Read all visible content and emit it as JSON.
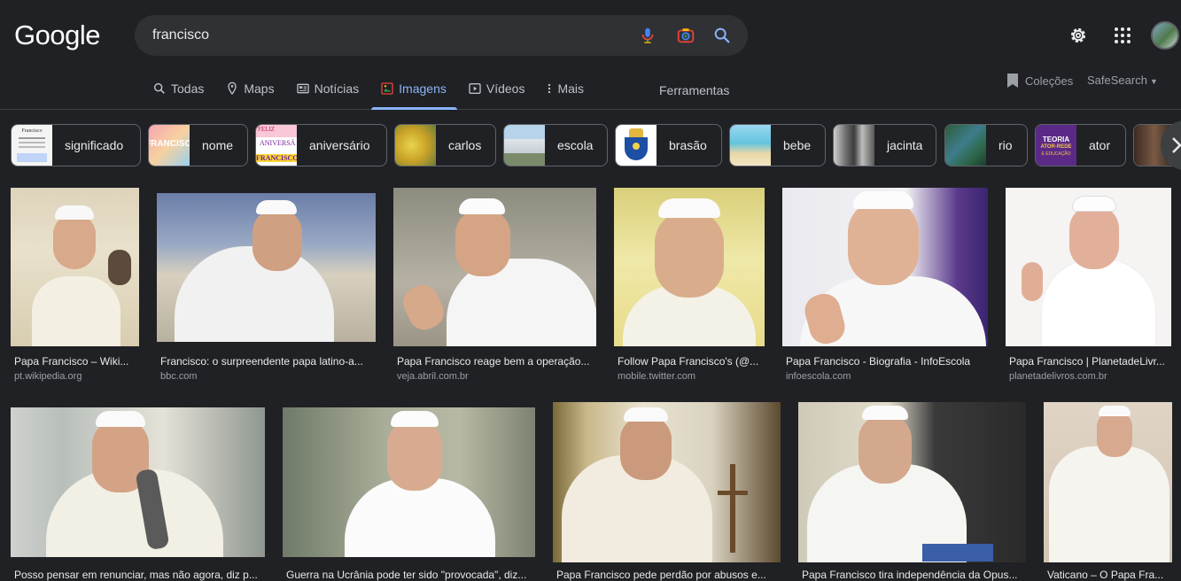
{
  "logo": "Google",
  "search": {
    "value": "francisco"
  },
  "tabs": [
    {
      "label": "Todas",
      "icon": "search-icon"
    },
    {
      "label": "Maps",
      "icon": "map-pin-icon"
    },
    {
      "label": "Notícias",
      "icon": "news-icon"
    },
    {
      "label": "Imagens",
      "icon": "image-icon",
      "active": true
    },
    {
      "label": "Vídeos",
      "icon": "play-icon"
    },
    {
      "label": "Mais",
      "icon": "more-vert-icon"
    }
  ],
  "tools_label": "Ferramentas",
  "collections_label": "Coleções",
  "safesearch_label": "SafeSearch",
  "chips": [
    {
      "label": "significado"
    },
    {
      "label": "nome"
    },
    {
      "label": "aniversário"
    },
    {
      "label": "carlos"
    },
    {
      "label": "escola"
    },
    {
      "label": "brasão"
    },
    {
      "label": "bebe"
    },
    {
      "label": "jacinta"
    },
    {
      "label": "rio"
    },
    {
      "label": "ator"
    }
  ],
  "chip_thumb_text": {
    "significado": "Francisco",
    "nome": "FRANCISCO",
    "aniversario_top": "FELIZ",
    "aniversario_mid": "ANIVERSÁ",
    "aniversario_bottom": "FRANCISCO",
    "ator_top": "TEORIA",
    "ator_mid": "ATOR-REDE",
    "ator_bottom": "E EDUCAÇÃO"
  },
  "results_row1": [
    {
      "title": "Papa Francisco – Wiki...",
      "source": "pt.wikipedia.org"
    },
    {
      "title": "Francisco: o surpreendente papa latino-a...",
      "source": "bbc.com"
    },
    {
      "title": "Papa Francisco reage bem a operação...",
      "source": "veja.abril.com.br"
    },
    {
      "title": "Follow Papa Francisco's (@...",
      "source": "mobile.twitter.com"
    },
    {
      "title": "Papa Francisco - Biografia - InfoEscola",
      "source": "infoescola.com"
    },
    {
      "title": "Papa Francisco | PlanetadeLivr...",
      "source": "planetadelivros.com.br"
    }
  ],
  "results_row2": [
    {
      "title": "Posso pensar em renunciar, mas não agora, diz p..."
    },
    {
      "title": "Guerra na Ucrânia pode ter sido \"provocada\", diz..."
    },
    {
      "title": "Papa Francisco pede perdão por abusos e..."
    },
    {
      "title": "Papa Francisco tira independência da Opus..."
    },
    {
      "title": "Vaticano – O Papa Fra..."
    }
  ]
}
